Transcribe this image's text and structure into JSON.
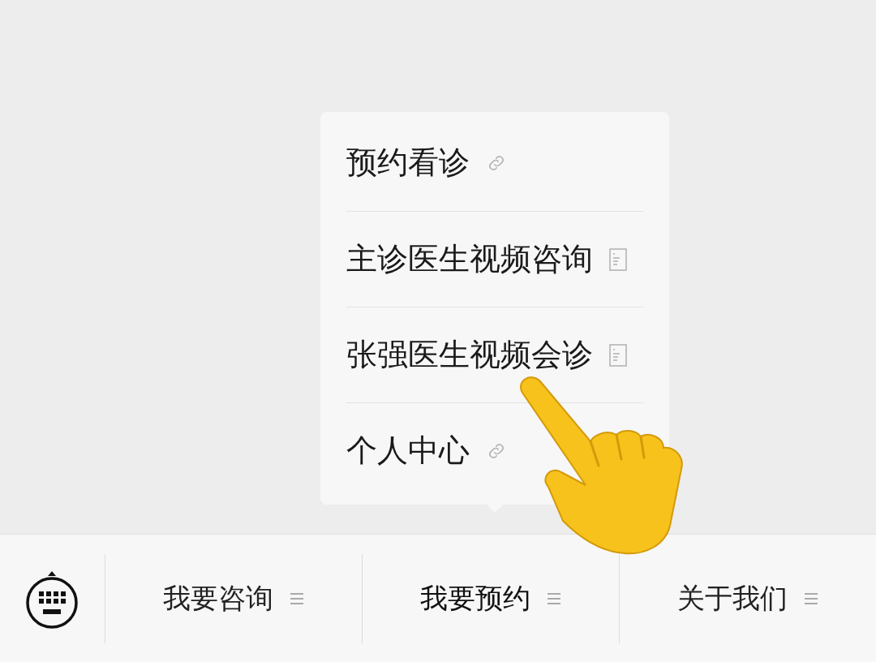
{
  "menu_bar": {
    "tabs": [
      {
        "label": "我要咨询",
        "expanded": false
      },
      {
        "label": "我要预约",
        "expanded": true,
        "submenu": [
          {
            "label": "预约看诊",
            "kind": "link"
          },
          {
            "label": "主诊医生视频咨询",
            "kind": "page"
          },
          {
            "label": "张强医生视频会诊",
            "kind": "page"
          },
          {
            "label": "个人中心",
            "kind": "link"
          }
        ]
      },
      {
        "label": "关于我们",
        "expanded": false
      }
    ]
  }
}
